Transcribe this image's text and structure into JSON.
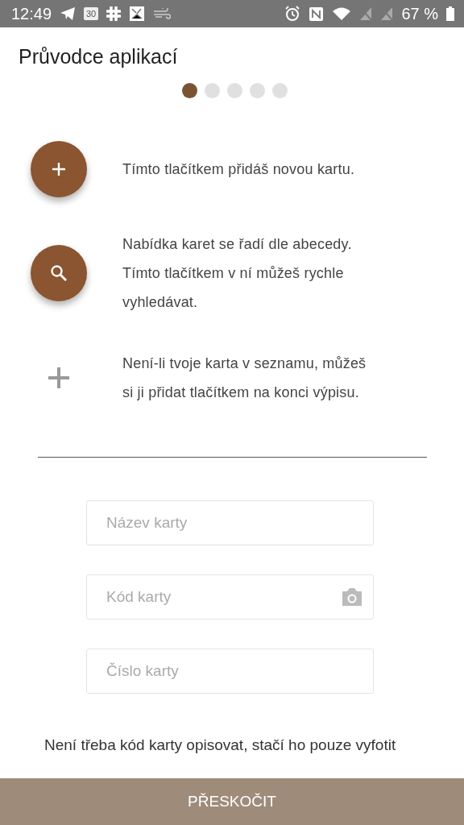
{
  "status_bar": {
    "time": "12:49",
    "calendar_day": "30",
    "battery": "67 %"
  },
  "header": {
    "title": "Průvodce aplikací"
  },
  "pager": [
    {
      "selected": true
    },
    {
      "selected": false
    },
    {
      "selected": false
    },
    {
      "selected": false
    },
    {
      "selected": false
    }
  ],
  "tips": [
    {
      "kind": "add-fab",
      "text": "Tímto tlačítkem přidáš novou kartu."
    },
    {
      "kind": "search-fab",
      "text": "Nabídka karet se řadí dle abecedy. Tímto tlačítkem v ní můžeš rychle vyhledávat."
    },
    {
      "kind": "plain-add",
      "text": "Není-li tvoje karta v seznamu, můžeš si ji přidat tlačítkem na konci výpisu."
    }
  ],
  "fields": [
    {
      "placeholder": "Název karty",
      "camera": false
    },
    {
      "placeholder": "Kód karty",
      "camera": true
    },
    {
      "placeholder": "Číslo karty",
      "camera": false
    }
  ],
  "note": "Není třeba kód karty opisovat, stačí ho pouze vyfotit",
  "skip_button": "PŘESKOČIT"
}
